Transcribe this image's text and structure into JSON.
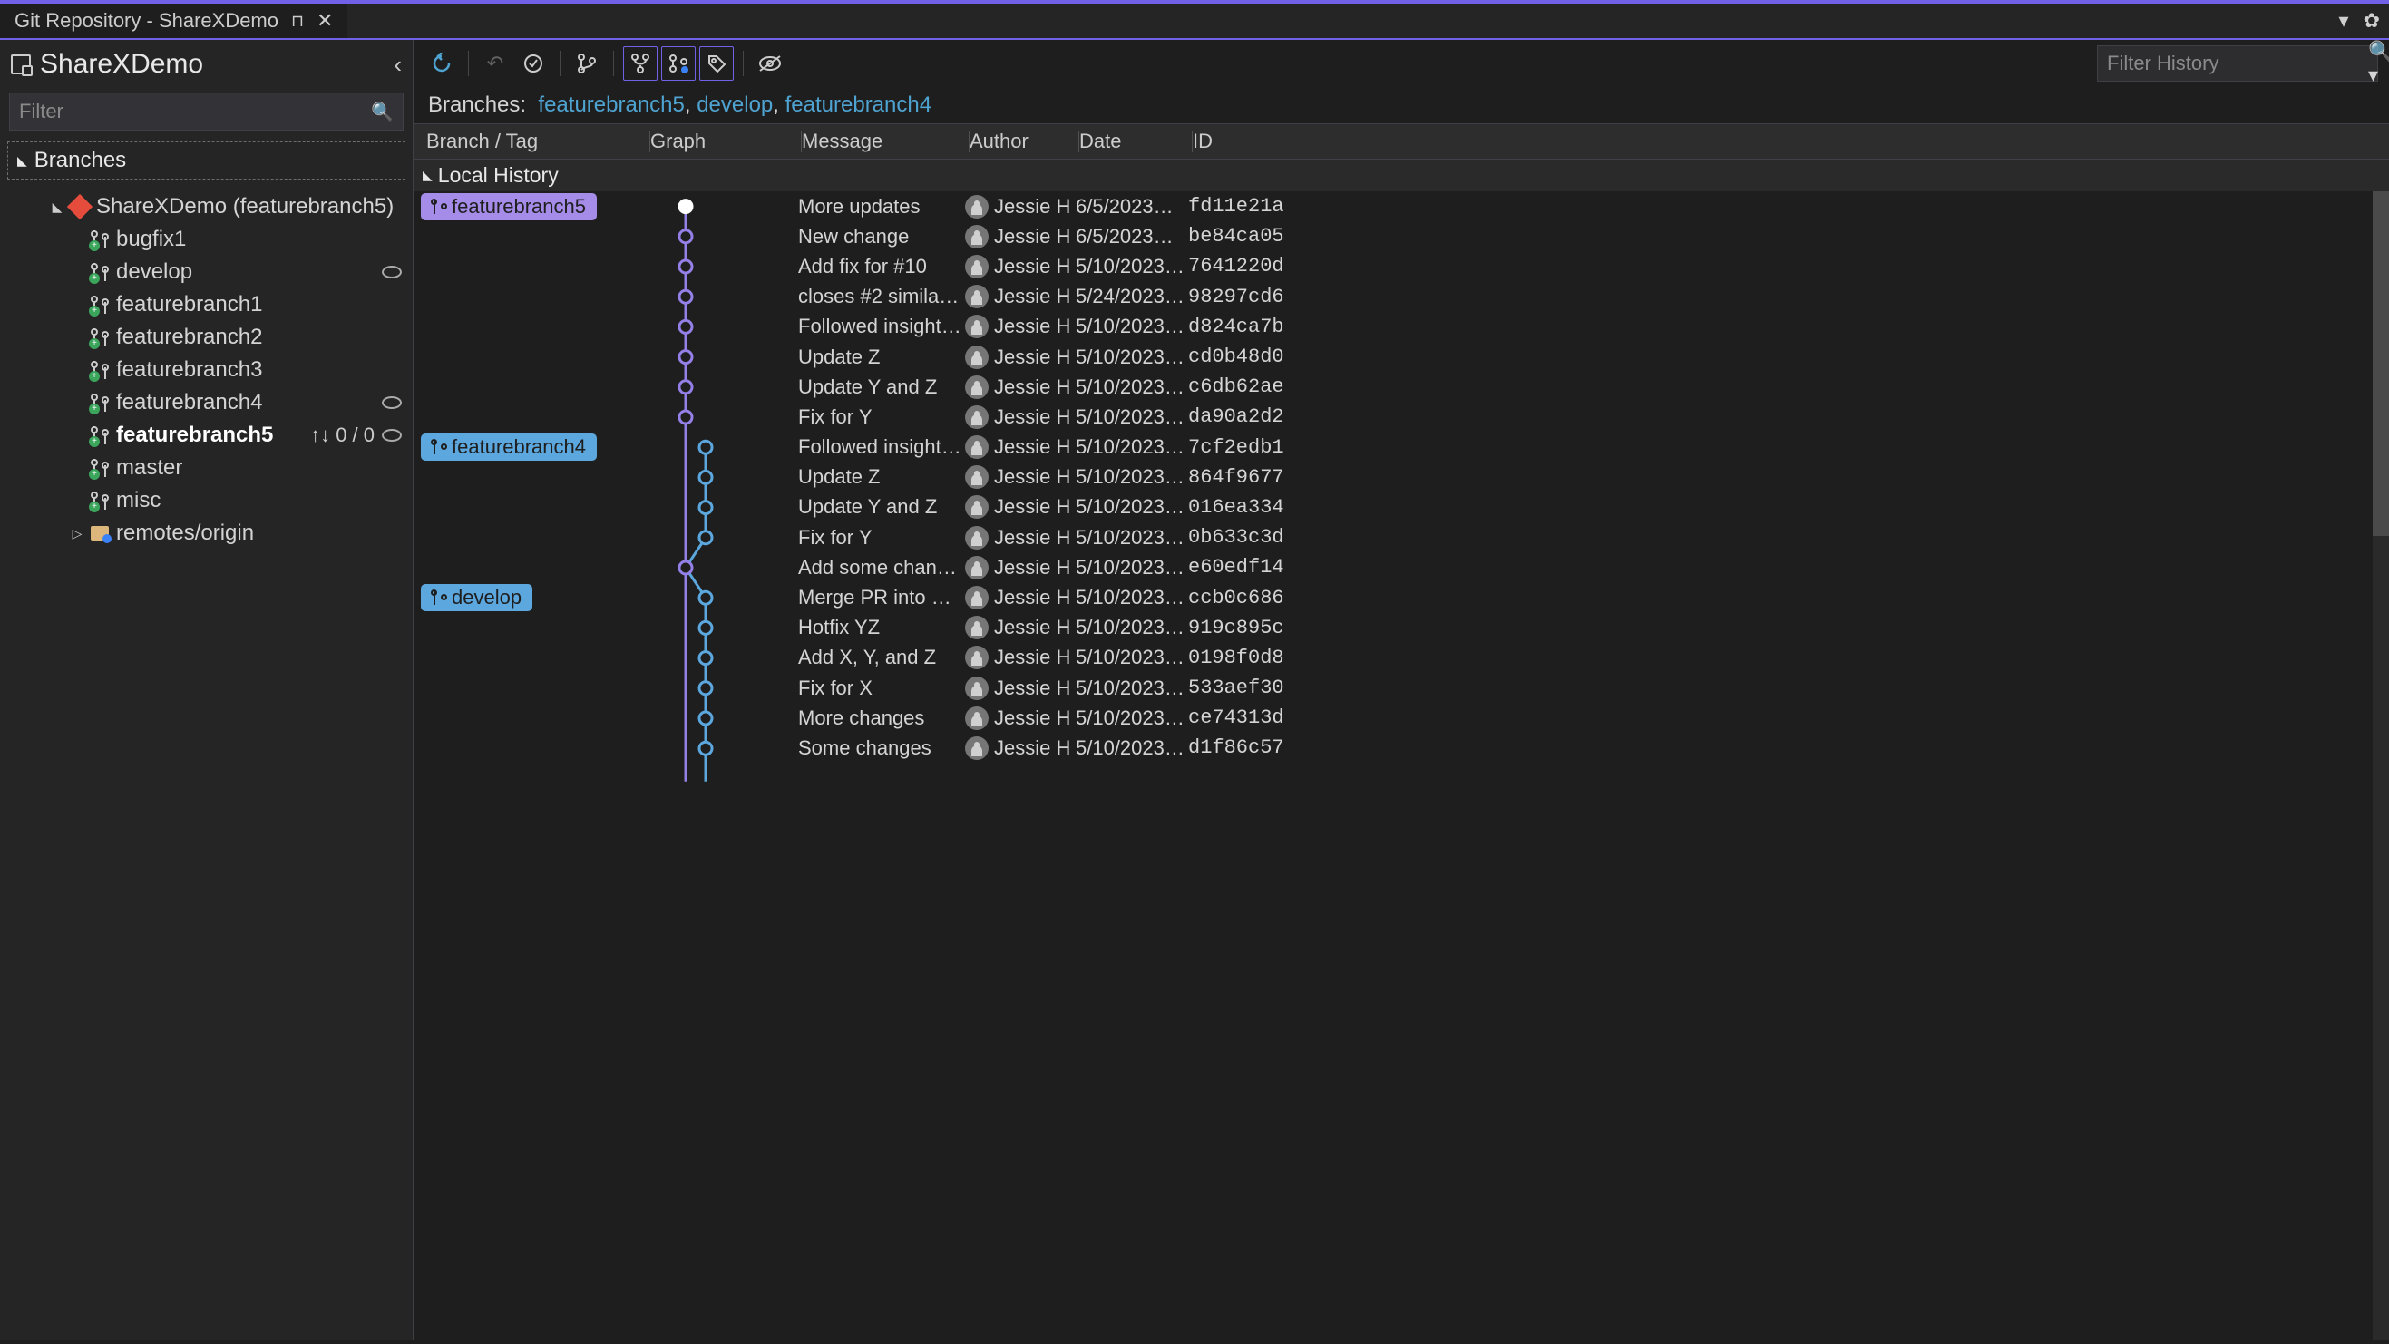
{
  "title": "Git Repository - ShareXDemo",
  "repo": {
    "name": "ShareXDemo",
    "current_branch": "(featurebranch5)"
  },
  "sidebar": {
    "filter_placeholder": "Filter",
    "branches_header": "Branches",
    "items": [
      {
        "label": "bugfix1",
        "icon": "branch"
      },
      {
        "label": "develop",
        "icon": "branch",
        "eye": true
      },
      {
        "label": "featurebranch1",
        "icon": "branch"
      },
      {
        "label": "featurebranch2",
        "icon": "branch"
      },
      {
        "label": "featurebranch3",
        "icon": "branch"
      },
      {
        "label": "featurebranch4",
        "icon": "branch",
        "eye": true
      },
      {
        "label": "featurebranch5",
        "icon": "branch",
        "bold": true,
        "sync": "0 / 0",
        "eye": true
      },
      {
        "label": "master",
        "icon": "branch"
      },
      {
        "label": "misc",
        "icon": "branch"
      }
    ],
    "remotes_label": "remotes/origin"
  },
  "toolbar": {
    "filter_history_placeholder": "Filter History"
  },
  "breadcrumb": {
    "label": "Branches:",
    "items": [
      "featurebranch5",
      "develop",
      "featurebranch4"
    ]
  },
  "columns": [
    "Branch / Tag",
    "Graph",
    "Message",
    "Author",
    "Date",
    "ID"
  ],
  "section_header": "Local History",
  "commits": [
    {
      "badge": "featurebranch5",
      "badge_color": "purple",
      "lane": 0,
      "head": true,
      "message": "More updates",
      "author": "Jessie H",
      "date": "6/5/2023…",
      "id": "fd11e21a"
    },
    {
      "lane": 0,
      "message": "New change",
      "author": "Jessie H",
      "date": "6/5/2023…",
      "id": "be84ca05"
    },
    {
      "lane": 0,
      "message": "Add fix for #10",
      "author": "Jessie H",
      "date": "5/10/2023…",
      "id": "7641220d"
    },
    {
      "lane": 0,
      "message": "closes #2 similar…",
      "author": "Jessie H",
      "date": "5/24/2023…",
      "id": "98297cd6"
    },
    {
      "lane": 0,
      "message": "Followed insight…",
      "author": "Jessie H",
      "date": "5/10/2023…",
      "id": "d824ca7b"
    },
    {
      "lane": 0,
      "message": "Update Z",
      "author": "Jessie H",
      "date": "5/10/2023…",
      "id": "cd0b48d0"
    },
    {
      "lane": 0,
      "message": "Update Y and Z",
      "author": "Jessie H",
      "date": "5/10/2023…",
      "id": "c6db62ae"
    },
    {
      "lane": 0,
      "message": "Fix for Y",
      "author": "Jessie H",
      "date": "5/10/2023…",
      "id": "da90a2d2"
    },
    {
      "badge": "featurebranch4",
      "badge_color": "blue",
      "lane": 1,
      "message": "Followed insight…",
      "author": "Jessie H",
      "date": "5/10/2023…",
      "id": "7cf2edb1"
    },
    {
      "lane": 1,
      "message": "Update Z",
      "author": "Jessie H",
      "date": "5/10/2023…",
      "id": "864f9677"
    },
    {
      "lane": 1,
      "message": "Update Y and Z",
      "author": "Jessie H",
      "date": "5/10/2023…",
      "id": "016ea334"
    },
    {
      "lane": 1,
      "message": "Fix for Y",
      "author": "Jessie H",
      "date": "5/10/2023…",
      "id": "0b633c3d"
    },
    {
      "lane": 0,
      "merge": true,
      "message": "Add some chan…",
      "author": "Jessie H",
      "date": "5/10/2023…",
      "id": "e60edf14"
    },
    {
      "badge": "develop",
      "badge_color": "blue",
      "lane": 1,
      "message": "Merge PR into d…",
      "author": "Jessie H",
      "date": "5/10/2023…",
      "id": "ccb0c686"
    },
    {
      "lane": 1,
      "message": "Hotfix YZ",
      "author": "Jessie H",
      "date": "5/10/2023…",
      "id": "919c895c"
    },
    {
      "lane": 1,
      "message": "Add X, Y, and Z",
      "author": "Jessie H",
      "date": "5/10/2023…",
      "id": "0198f0d8"
    },
    {
      "lane": 1,
      "message": "Fix for X",
      "author": "Jessie H",
      "date": "5/10/2023…",
      "id": "533aef30"
    },
    {
      "lane": 1,
      "message": "More changes",
      "author": "Jessie H",
      "date": "5/10/2023…",
      "id": "ce74313d"
    },
    {
      "lane": 1,
      "message": "Some changes",
      "author": "Jessie H",
      "date": "5/10/2023…",
      "id": "d1f86c57"
    }
  ]
}
